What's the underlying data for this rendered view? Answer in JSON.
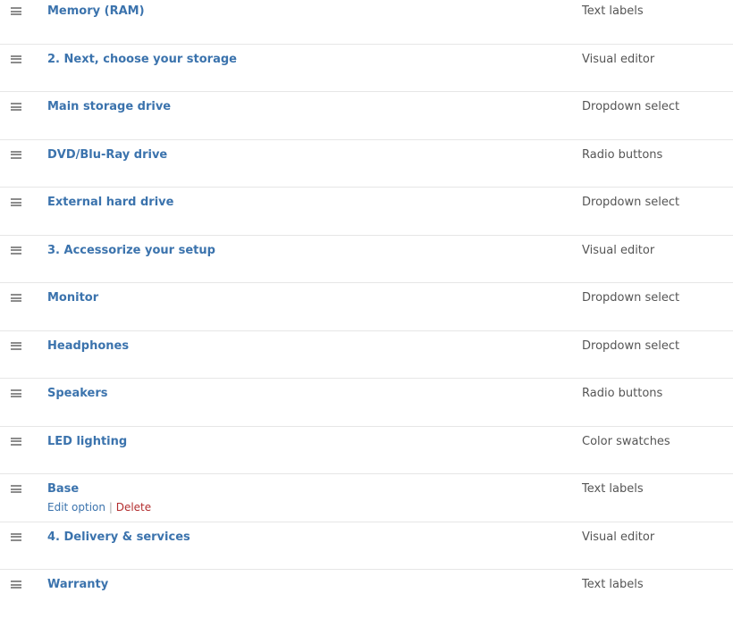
{
  "rows": [
    {
      "title": "Memory (RAM)",
      "type": "Text labels"
    },
    {
      "title": "2. Next, choose your storage",
      "type": "Visual editor"
    },
    {
      "title": "Main storage drive",
      "type": "Dropdown select"
    },
    {
      "title": "DVD/Blu-Ray drive",
      "type": "Radio buttons"
    },
    {
      "title": "External hard drive",
      "type": "Dropdown select"
    },
    {
      "title": "3. Accessorize your setup",
      "type": "Visual editor"
    },
    {
      "title": "Monitor",
      "type": "Dropdown select"
    },
    {
      "title": "Headphones",
      "type": "Dropdown select"
    },
    {
      "title": "Speakers",
      "type": "Radio buttons"
    },
    {
      "title": "LED lighting",
      "type": "Color swatches"
    },
    {
      "title": "Base",
      "type": "Text labels",
      "actions": {
        "edit": "Edit option",
        "separator": "|",
        "delete": "Delete"
      }
    },
    {
      "title": "4. Delivery & services",
      "type": "Visual editor"
    },
    {
      "title": "Warranty",
      "type": "Text labels"
    }
  ],
  "colors": {
    "link": "#3b73ad",
    "delete": "#b32d2e",
    "type_text": "#555555"
  }
}
